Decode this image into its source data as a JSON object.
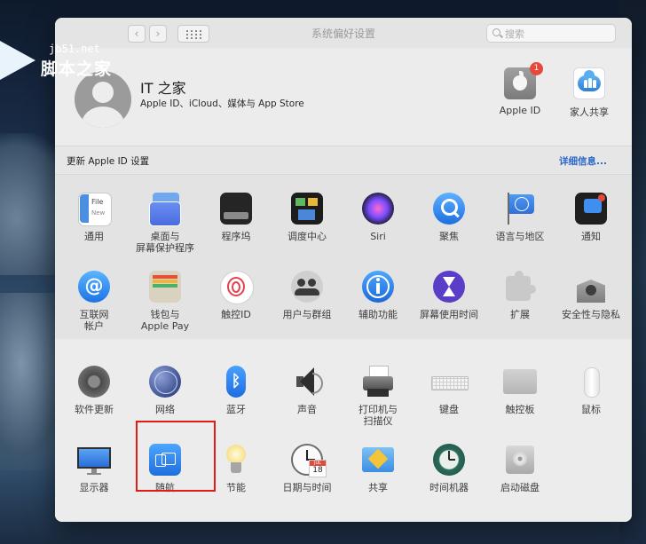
{
  "watermark": {
    "url": "jb51.net",
    "name": "脚本之家"
  },
  "window": {
    "title": "系统偏好设置",
    "search_placeholder": "搜索",
    "back": "‹",
    "forward": "›"
  },
  "account": {
    "name": "IT 之家",
    "subtitle": "Apple ID、iCloud、媒体与 App Store",
    "apple_id_label": "Apple ID",
    "apple_id_badge": "1",
    "family_label": "家人共享"
  },
  "update": {
    "text": "更新 Apple ID 设置",
    "link": "详细信息..."
  },
  "prefs_row1": [
    {
      "label": "通用",
      "icon": "general-icon"
    },
    {
      "label": "桌面与\n屏幕保护程序",
      "icon": "desktop-screensaver-icon"
    },
    {
      "label": "程序坞",
      "icon": "dock-icon"
    },
    {
      "label": "调度中心",
      "icon": "mission-control-icon"
    },
    {
      "label": "Siri",
      "icon": "siri-icon"
    },
    {
      "label": "聚焦",
      "icon": "spotlight-icon"
    },
    {
      "label": "语言与地区",
      "icon": "language-region-icon"
    },
    {
      "label": "通知",
      "icon": "notifications-icon"
    }
  ],
  "prefs_row2": [
    {
      "label": "互联网\n帐户",
      "icon": "internet-accounts-icon"
    },
    {
      "label": "钱包与\nApple Pay",
      "icon": "wallet-icon"
    },
    {
      "label": "触控ID",
      "icon": "touch-id-icon"
    },
    {
      "label": "用户与群组",
      "icon": "users-groups-icon"
    },
    {
      "label": "辅助功能",
      "icon": "accessibility-icon"
    },
    {
      "label": "屏幕使用时间",
      "icon": "screen-time-icon"
    },
    {
      "label": "扩展",
      "icon": "extensions-icon"
    },
    {
      "label": "安全性与隐私",
      "icon": "security-privacy-icon"
    }
  ],
  "prefs_row3": [
    {
      "label": "软件更新",
      "icon": "software-update-icon"
    },
    {
      "label": "网络",
      "icon": "network-icon"
    },
    {
      "label": "蓝牙",
      "icon": "bluetooth-icon"
    },
    {
      "label": "声音",
      "icon": "sound-icon"
    },
    {
      "label": "打印机与\n扫描仪",
      "icon": "printers-scanners-icon"
    },
    {
      "label": "键盘",
      "icon": "keyboard-icon"
    },
    {
      "label": "触控板",
      "icon": "trackpad-icon"
    },
    {
      "label": "鼠标",
      "icon": "mouse-icon"
    }
  ],
  "prefs_row4": [
    {
      "label": "显示器",
      "icon": "displays-icon"
    },
    {
      "label": "随航",
      "icon": "sidecar-icon"
    },
    {
      "label": "节能",
      "icon": "energy-saver-icon"
    },
    {
      "label": "日期与时间",
      "icon": "date-time-icon"
    },
    {
      "label": "共享",
      "icon": "sharing-icon"
    },
    {
      "label": "时间机器",
      "icon": "time-machine-icon"
    },
    {
      "label": "启动磁盘",
      "icon": "startup-disk-icon"
    }
  ],
  "calendar": {
    "month": "JUL",
    "day": "18"
  },
  "colors": {
    "highlight": "#e11a1a",
    "link": "#2a67c9",
    "badge": "#e8483c"
  }
}
